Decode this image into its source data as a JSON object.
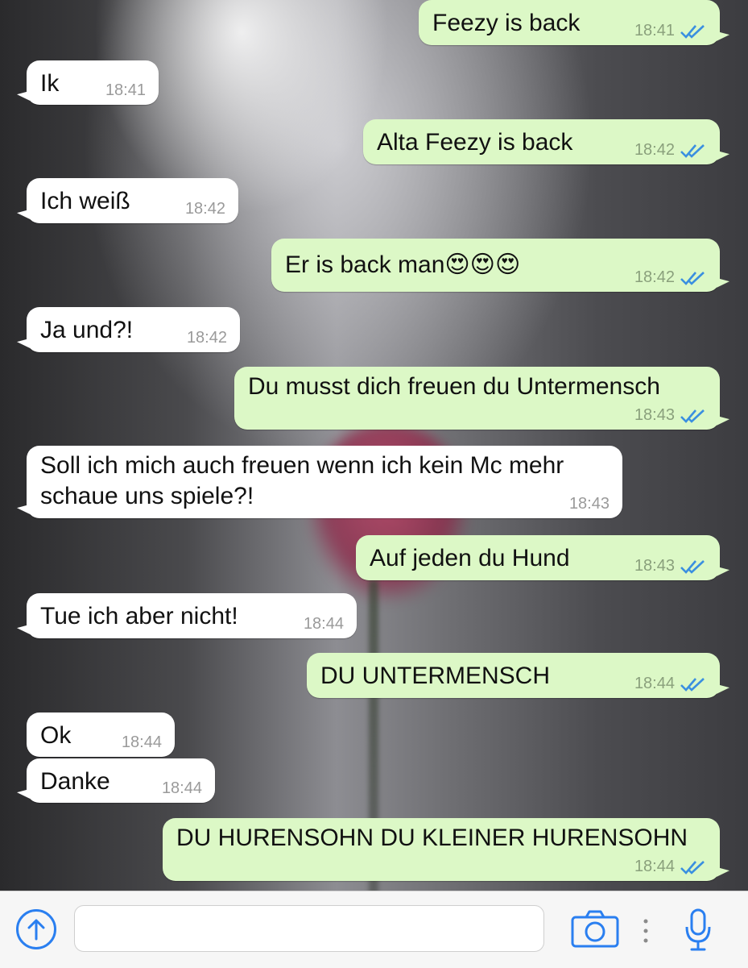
{
  "messages": [
    {
      "dir": "out",
      "text": "Feezy is back",
      "time": "18:41"
    },
    {
      "dir": "in",
      "text": "Ik",
      "time": "18:41"
    },
    {
      "dir": "out",
      "text": "Alta Feezy is back",
      "time": "18:42"
    },
    {
      "dir": "in",
      "text": "Ich weiß",
      "time": "18:42"
    },
    {
      "dir": "out",
      "text": "Er is back man😍😍😍",
      "time": "18:42"
    },
    {
      "dir": "in",
      "text": "Ja und?!",
      "time": "18:42"
    },
    {
      "dir": "out",
      "text": "Du musst dich freuen du Untermensch",
      "time": "18:43"
    },
    {
      "dir": "in",
      "text": "Soll ich mich auch freuen wenn ich kein Mc mehr\nschaue uns spiele?!",
      "time": "18:43"
    },
    {
      "dir": "out",
      "text": "Auf jeden du Hund",
      "time": "18:43"
    },
    {
      "dir": "in",
      "text": "Tue ich aber nicht!",
      "time": "18:44"
    },
    {
      "dir": "out",
      "text": "DU UNTERMENSCH",
      "time": "18:44"
    },
    {
      "dir": "in",
      "text": "Ok",
      "time": "18:44"
    },
    {
      "dir": "in",
      "text": "Danke",
      "time": "18:44"
    },
    {
      "dir": "out",
      "text": "DU HURENSOHN DU KLEINER HURENSOHN",
      "time": "18:44"
    }
  ],
  "status_icons": {
    "read_receipt": "double-check-icon",
    "read_color": "#3a8fe0"
  },
  "composer": {
    "input_value": "",
    "left_icon": "upload-circle-icon",
    "right_icons": [
      "camera-icon",
      "more-dots-icon",
      "microphone-icon"
    ],
    "accent_color": "#2a7ff0"
  }
}
